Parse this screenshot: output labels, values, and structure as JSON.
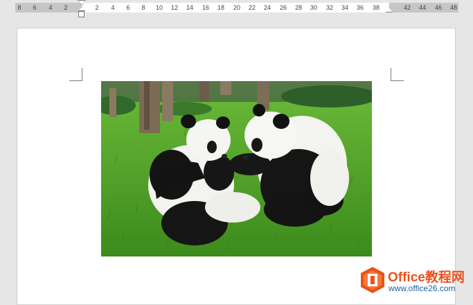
{
  "ruler": {
    "left_labels": [
      "8",
      "6",
      "4",
      "2"
    ],
    "main_labels": [
      "2",
      "4",
      "6",
      "8",
      "10",
      "12",
      "14",
      "16",
      "18",
      "20",
      "22",
      "24",
      "26",
      "28",
      "30",
      "32",
      "34",
      "36",
      "38"
    ],
    "right_labels": [
      "42",
      "44",
      "46",
      "48"
    ]
  },
  "document": {
    "image_alt": "Two giant pandas sitting on grass"
  },
  "watermark": {
    "title": "Office教程网",
    "url": "www.office26.com"
  },
  "colors": {
    "page_bg": "#ffffff",
    "app_bg": "#e6e6e6",
    "watermark_orange": "#e8531f",
    "watermark_blue": "#1a5fa8"
  }
}
